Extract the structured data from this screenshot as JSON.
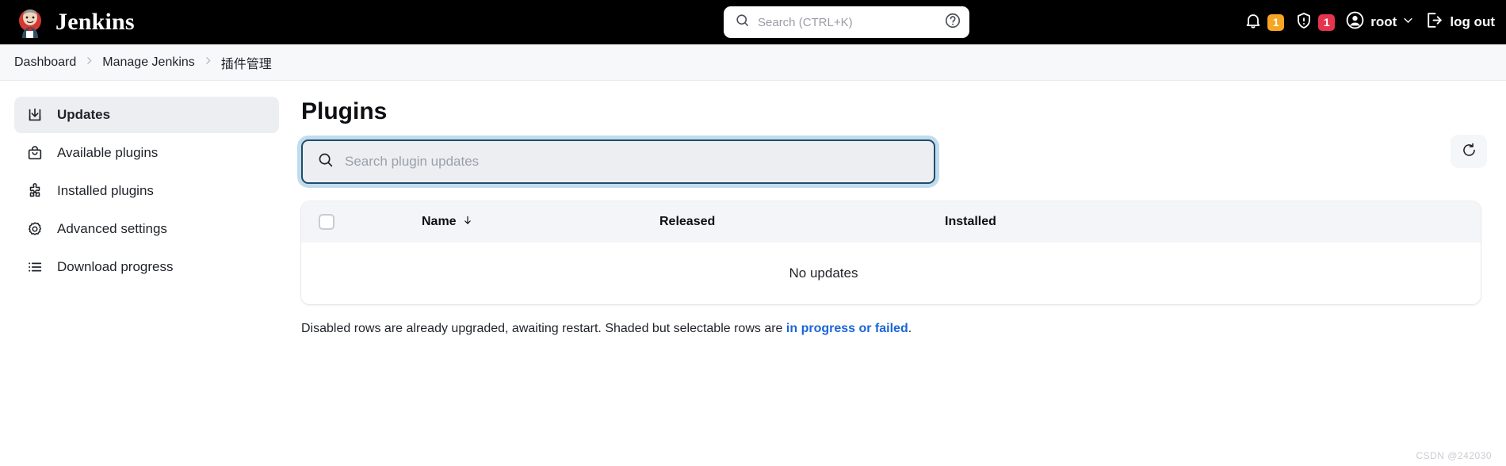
{
  "header": {
    "brand": "Jenkins",
    "brand_logo_icon": "jenkins-butler-logo",
    "search_icon": "search-icon",
    "search_placeholder": "Search (CTRL+K)",
    "search_value": "",
    "help_icon": "help-circle-icon",
    "bell_icon": "bell-icon",
    "bell_badge": "1",
    "bell_badge_color": "#f5a623",
    "security_icon": "shield-warning-icon",
    "security_badge": "1",
    "security_badge_color": "#e5344d",
    "user_icon": "user-circle-icon",
    "user_name": "root",
    "user_chevron_icon": "chevron-down-icon",
    "logout_icon": "logout-arrow-icon",
    "logout_label": "log out"
  },
  "breadcrumb": {
    "items": [
      "Dashboard",
      "Manage Jenkins",
      "插件管理"
    ],
    "separator_icon": "chevron-right-icon"
  },
  "sidebar": {
    "items": [
      {
        "label": "Updates",
        "icon": "download-box-icon",
        "active": true
      },
      {
        "label": "Available plugins",
        "icon": "bag-icon",
        "active": false
      },
      {
        "label": "Installed plugins",
        "icon": "puzzle-piece-icon",
        "active": false
      },
      {
        "label": "Advanced settings",
        "icon": "gear-icon",
        "active": false
      },
      {
        "label": "Download progress",
        "icon": "list-icon",
        "active": false
      }
    ]
  },
  "main": {
    "title": "Plugins",
    "plugin_search": {
      "icon": "search-icon",
      "placeholder": "Search plugin updates",
      "value": ""
    },
    "refresh_button": {
      "icon": "refresh-icon",
      "label": ""
    },
    "table": {
      "select_all_checkbox": "select-all-checkbox",
      "columns": [
        {
          "label": "Name",
          "sort_icon": "arrow-down-icon"
        },
        {
          "label": "Released",
          "sort_icon": ""
        },
        {
          "label": "Installed",
          "sort_icon": ""
        }
      ],
      "rows": [],
      "empty_message": "No updates"
    },
    "footnote": {
      "text_before": "Disabled rows are already upgraded, awaiting restart. Shaded but selectable rows are ",
      "link_text": "in progress or failed",
      "text_after": "."
    }
  },
  "watermark": "CSDN @242030",
  "colors": {
    "appbar_bg": "#000000",
    "accent_link": "#1a65d8",
    "focus_ring": "#c2dced",
    "focus_border": "#1d4e6b"
  }
}
